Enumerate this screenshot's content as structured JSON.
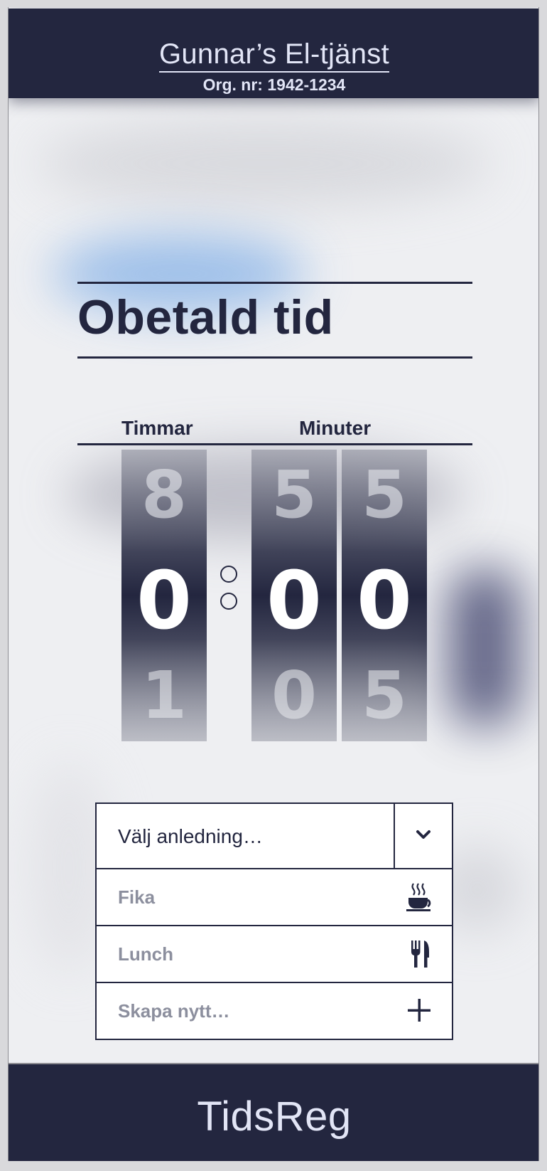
{
  "header": {
    "company": "Gunnar’s El-tjänst",
    "org_nr": "Org. nr: 1942-1234"
  },
  "page": {
    "title": "Obetald tid"
  },
  "time_picker": {
    "hours_label": "Timmar",
    "minutes_label": "Minuter",
    "wheels": [
      {
        "prev": "8",
        "current": "0",
        "next": "1"
      },
      {
        "prev": "5",
        "current": "0",
        "next": "0"
      },
      {
        "prev": "5",
        "current": "0",
        "next": "5"
      }
    ]
  },
  "reason_select": {
    "placeholder": "Välj anledning…",
    "options": [
      {
        "label": "Fika",
        "icon": "coffee-cup-icon"
      },
      {
        "label": "Lunch",
        "icon": "fork-knife-icon"
      },
      {
        "label": "Skapa nytt…",
        "icon": "plus-icon"
      }
    ]
  },
  "footer": {
    "brand": "TidsReg"
  },
  "colors": {
    "navy": "#23263f",
    "light_text": "#e2e5f6",
    "muted_option": "#8c8f9e",
    "background": "#eeeff2"
  }
}
